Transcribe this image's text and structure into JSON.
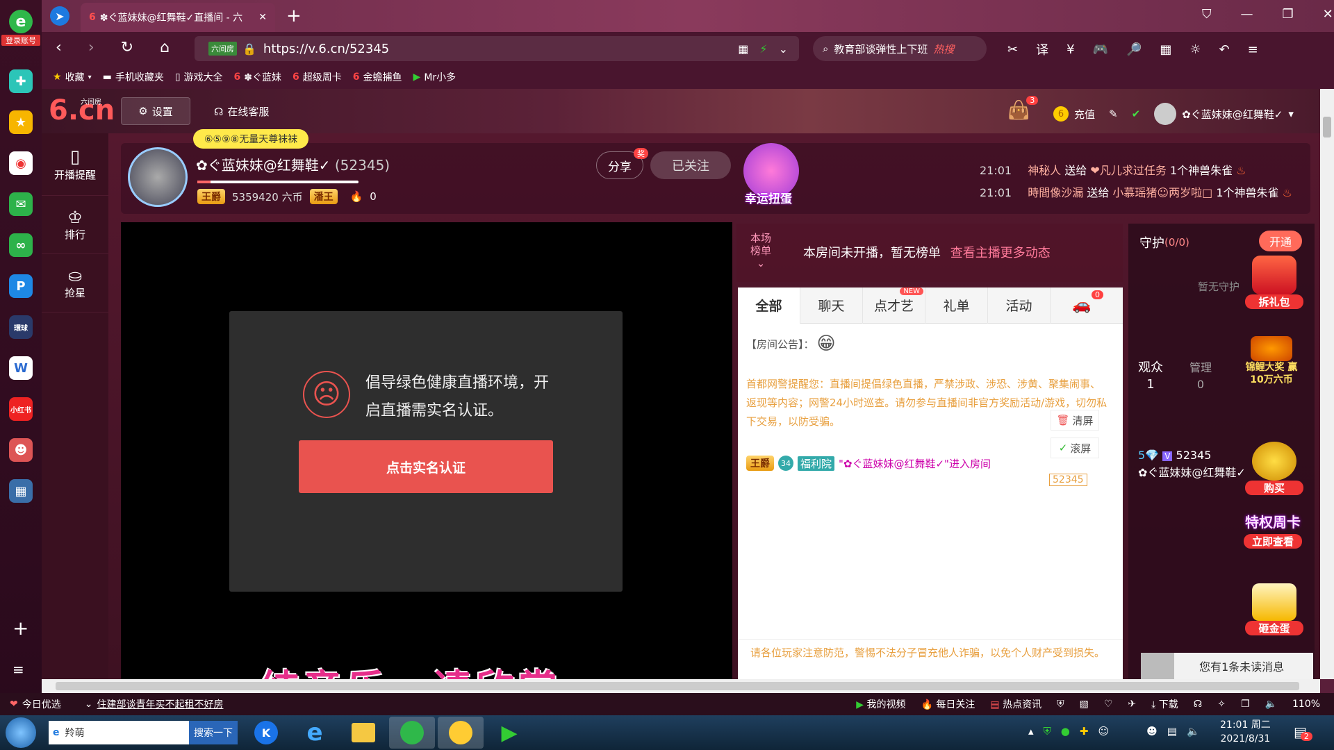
{
  "browser": {
    "rail": {
      "top_label": "登录账号",
      "items": [
        "plus-icon",
        "star-icon",
        "weibo-icon",
        "mail-icon",
        "cloud-icon",
        "p-icon",
        "news-icon",
        "word-icon",
        "xiaohongshu-icon",
        "game-icon",
        "map-icon"
      ]
    },
    "tab_title": "✽ぐ蓝妹妹@红舞鞋✓直播间 - 六",
    "url": "https://v.6.cn/52345",
    "url_prefix": "六间房",
    "search_text": "教育部谈弹性上下班",
    "search_hot": "热搜",
    "favorites": [
      "收藏",
      "手机收藏夹",
      "游戏大全",
      "✽ぐ蓝妹",
      "超级周卡",
      "金蟾捕鱼",
      "Mr小多"
    ]
  },
  "site": {
    "logo": "6.cn",
    "logo_sub": "六间房",
    "settings_label": "设置",
    "service_label": "在线客服",
    "bag_count": "3",
    "recharge_label": "充值",
    "user_name": "✿ぐ蓝妹妹@红舞鞋✓",
    "nav": [
      {
        "label": "开播提醒"
      },
      {
        "label": "排行"
      },
      {
        "label": "抢星"
      }
    ]
  },
  "anchor": {
    "tag": "⑥⑤⑨⑧无量天尊袜袜",
    "name": "✿ぐ蓝妹妹@红舞鞋✓",
    "room_id": "(52345)",
    "rank_badge": "王爵",
    "coins": "5359420 六币",
    "second_badge": "潘王",
    "fire_count": "0",
    "share_label": "分享",
    "share_badge": "奖",
    "follow_label": "已关注",
    "lucky_label": "幸运扭蛋"
  },
  "gift_feed": [
    {
      "time": "21:01",
      "from": "神秘人",
      "action": "送给",
      "to": "❤凡儿求过任务",
      "gift": "1个神兽朱雀"
    },
    {
      "time": "21:01",
      "from": "時間像沙漏",
      "action": "送给",
      "to": "小慕瑶猪☺两岁啦□",
      "gift": "1个神兽朱雀"
    }
  ],
  "video": {
    "notice_line1": "倡导绿色健康直播环境，开",
    "notice_line2": "启直播需实名认证。",
    "auth_button": "点击实名认证",
    "overlay_caption": "纯音乐，请欣赏"
  },
  "rankbar": {
    "label_line1": "本场",
    "label_line2": "榜单",
    "text": "本房间未开播，暂无榜单",
    "link": "查看主播更多动态"
  },
  "chat": {
    "tabs": [
      "全部",
      "聊天",
      "点才艺",
      "礼单",
      "活动"
    ],
    "new_badge": "NEW",
    "car_badge": "0",
    "announcement": "【房间公告】：",
    "warning": "首都网警提醒您：直播间提倡绿色直播，严禁涉政、涉恐、涉黄、聚集闹事、返现等内容；网警24小时巡查。请勿参与直播间非官方奖励活动/游戏，切勿私下交易，以防受骗。",
    "clear_label": "清屏",
    "scroll_label": "滚屏",
    "entry_badge": "王爵",
    "entry_level": "34",
    "entry_tag": "福利院",
    "entry_user": "\"✿ぐ蓝妹妹@红舞鞋✓\"进入房间",
    "car_id": "52345",
    "footer": "请各位玩家注意防范，警惕不法分子冒充他人诈骗，以免个人财产受到损失。"
  },
  "guard": {
    "title": "守护",
    "count": "(0/0)",
    "open_label": "开通",
    "empty": "暂无守护",
    "audience_label": "观众",
    "audience_count": "1",
    "admin_label": "管理",
    "admin_count": "0",
    "viewer_id": "52345",
    "viewer_name": "✿ぐ蓝妹妹@红舞鞋✓",
    "promos": [
      "拆礼包",
      "锦鲤大奖 赢10万六币",
      "购买",
      "特权周卡",
      "立即查看",
      "砸金蛋"
    ],
    "unread": "您有1条未读消息"
  },
  "statusbar": {
    "left1": "今日优选",
    "left2": "住建部谈青年买不起租不好房",
    "right": [
      "我的视频",
      "每日关注",
      "热点资讯",
      "下载"
    ],
    "zoom": "110%"
  },
  "taskbar": {
    "search_text": "羚萌",
    "search_button": "搜索一下",
    "time": "21:01 周二",
    "date": "2021/8/31",
    "notif": "2"
  }
}
